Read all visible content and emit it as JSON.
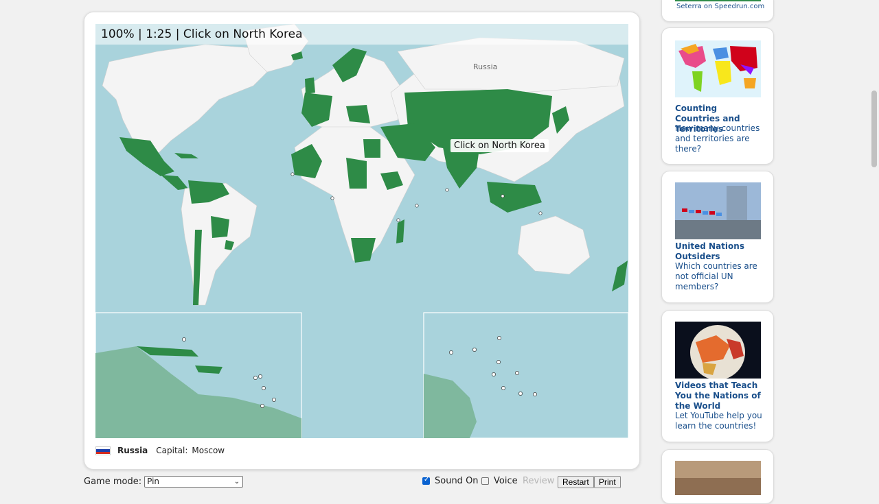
{
  "game": {
    "status_text": "100% | 1:25 | Click on North Korea",
    "tooltip": "Click on North Korea",
    "map_label": "Russia",
    "info": {
      "country": "Russia",
      "capital_label": "Capital:",
      "capital": "Moscow"
    },
    "colors": {
      "ocean": "#a9d3dc",
      "land": "#f4f4f4",
      "done": "#2e8b47",
      "inset_land": "#7fb89e"
    }
  },
  "controls": {
    "game_mode_label": "Game mode:",
    "game_mode_value": "Pin",
    "sound_label": "Sound On",
    "sound_checked": true,
    "voice_label": "Voice",
    "voice_checked": false,
    "review_label": "Review",
    "restart_label": "Restart",
    "print_label": "Print"
  },
  "sidebar": {
    "top_link": "Seterra on Speedrun.com",
    "cards": [
      {
        "title": "Counting Countries and Territories",
        "desc": "How many countries and territories are there?",
        "icon": "colorful-world-map-image"
      },
      {
        "title": "United Nations Outsiders",
        "desc": "Which countries are not official UN members?",
        "icon": "un-headquarters-image"
      },
      {
        "title": "Videos that Teach You the Nations of the World",
        "desc": "Let YouTube help you learn the countries!",
        "icon": "globe-image"
      }
    ]
  }
}
